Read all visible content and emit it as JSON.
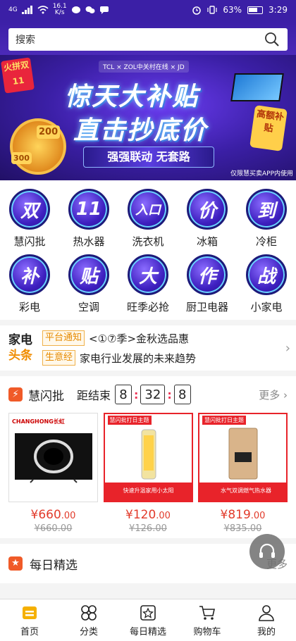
{
  "status_bar": {
    "net_type": "4G",
    "net_speed": "16.1\nK/s",
    "battery": "63%",
    "time": "3:29"
  },
  "search": {
    "placeholder": "搜索"
  },
  "banner": {
    "brands": "TCL × ZOL中关村在线 × JD",
    "badge_left": "火拼双11",
    "title_line1": "惊天大补贴",
    "title_line2": "直击抄底价",
    "slogan": "强强联动 无套路",
    "tag_right": "高额补贴",
    "coupon_1": "200",
    "coupon_2": "300",
    "note": "仅限慧买卖APP内使用"
  },
  "categories": [
    {
      "icon_text": "双",
      "label": "慧闪批"
    },
    {
      "icon_text": "11",
      "label": "热水器"
    },
    {
      "icon_text": "入口",
      "label": "洗衣机"
    },
    {
      "icon_text": "价",
      "label": "冰箱"
    },
    {
      "icon_text": "到",
      "label": "冷柜"
    },
    {
      "icon_text": "补",
      "label": "彩电"
    },
    {
      "icon_text": "贴",
      "label": "空调"
    },
    {
      "icon_text": "大",
      "label": "旺季必抢"
    },
    {
      "icon_text": "作",
      "label": "厨卫电器"
    },
    {
      "icon_text": "战",
      "label": "小家电"
    }
  ],
  "news": {
    "brand_line1": "家电",
    "brand_line2": "头条",
    "items": [
      {
        "tag": "平台通知",
        "text": "<①⑦季>金秋选品惠"
      },
      {
        "tag": "生意经",
        "text": "家电行业发展的未来趋势"
      }
    ]
  },
  "flash_sale": {
    "title": "慧闪批",
    "countdown_label": "距结束",
    "hours": "8",
    "minutes": "32",
    "seconds": "8",
    "more": "更多",
    "products": [
      {
        "brand": "CHANGHONG长虹",
        "price_int": "¥660",
        "price_dec": ".00",
        "old_price": "¥660.00",
        "caption": ""
      },
      {
        "brand": "慧闪批打日主题",
        "price_int": "¥120",
        "price_dec": ".00",
        "old_price": "¥126.00",
        "caption": "快速升温家用小太阳"
      },
      {
        "brand": "慧闪批打日主题",
        "price_int": "¥819",
        "price_dec": ".00",
        "old_price": "¥835.00",
        "caption": "水气双调燃气热水器"
      }
    ]
  },
  "daily_picks": {
    "title": "每日精选",
    "more": "更多"
  },
  "bottom_nav": [
    {
      "icon": "home-icon",
      "label": "首页"
    },
    {
      "icon": "category-icon",
      "label": "分类"
    },
    {
      "icon": "star-box-icon",
      "label": "每日精选"
    },
    {
      "icon": "cart-icon",
      "label": "购物车"
    },
    {
      "icon": "user-icon",
      "label": "我的"
    }
  ],
  "colors": {
    "brand_purple": "#3b1fa6",
    "accent_orange": "#f05a28",
    "price_red": "#e23b2b",
    "nav_active": "#f5b000"
  }
}
